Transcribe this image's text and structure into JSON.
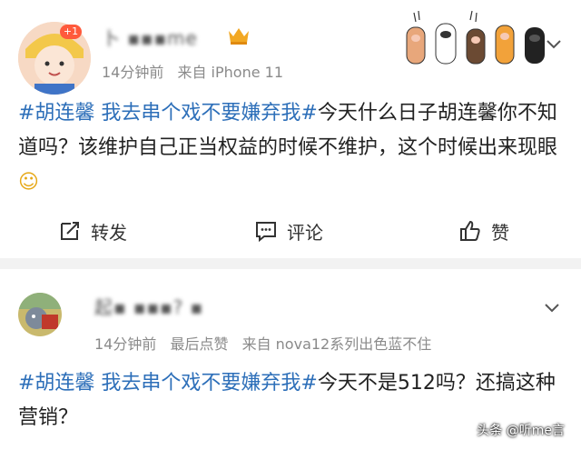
{
  "posts": [
    {
      "username": "卜 ▪▪▪me",
      "badge": "+1",
      "time": "14分钟前",
      "source": "来自 iPhone 11",
      "tag": "#胡连馨 我去串个戏不要嫌弃我#",
      "text": "今天什么日子胡连馨你不知道吗？该维护自己正当权益的时候不维护，这个时候出来现眼",
      "emoji": "☺"
    },
    {
      "username": "起▪ ▪▪▪? ▪",
      "time": "14分钟前",
      "extra": "最后点赞",
      "source": "来自 nova12系列出色蓝不住",
      "tag": "#胡连馨 我去串个戏不要嫌弃我#",
      "text": "今天不是512吗？还搞这种营销？"
    }
  ],
  "actions": {
    "repost": "转发",
    "comment": "评论",
    "like": "赞"
  },
  "watermark": "头条 @听me言",
  "colors": {
    "tag": "#2d6fb9",
    "meta": "#8a8a8a",
    "badge": "#ff5a3c"
  }
}
